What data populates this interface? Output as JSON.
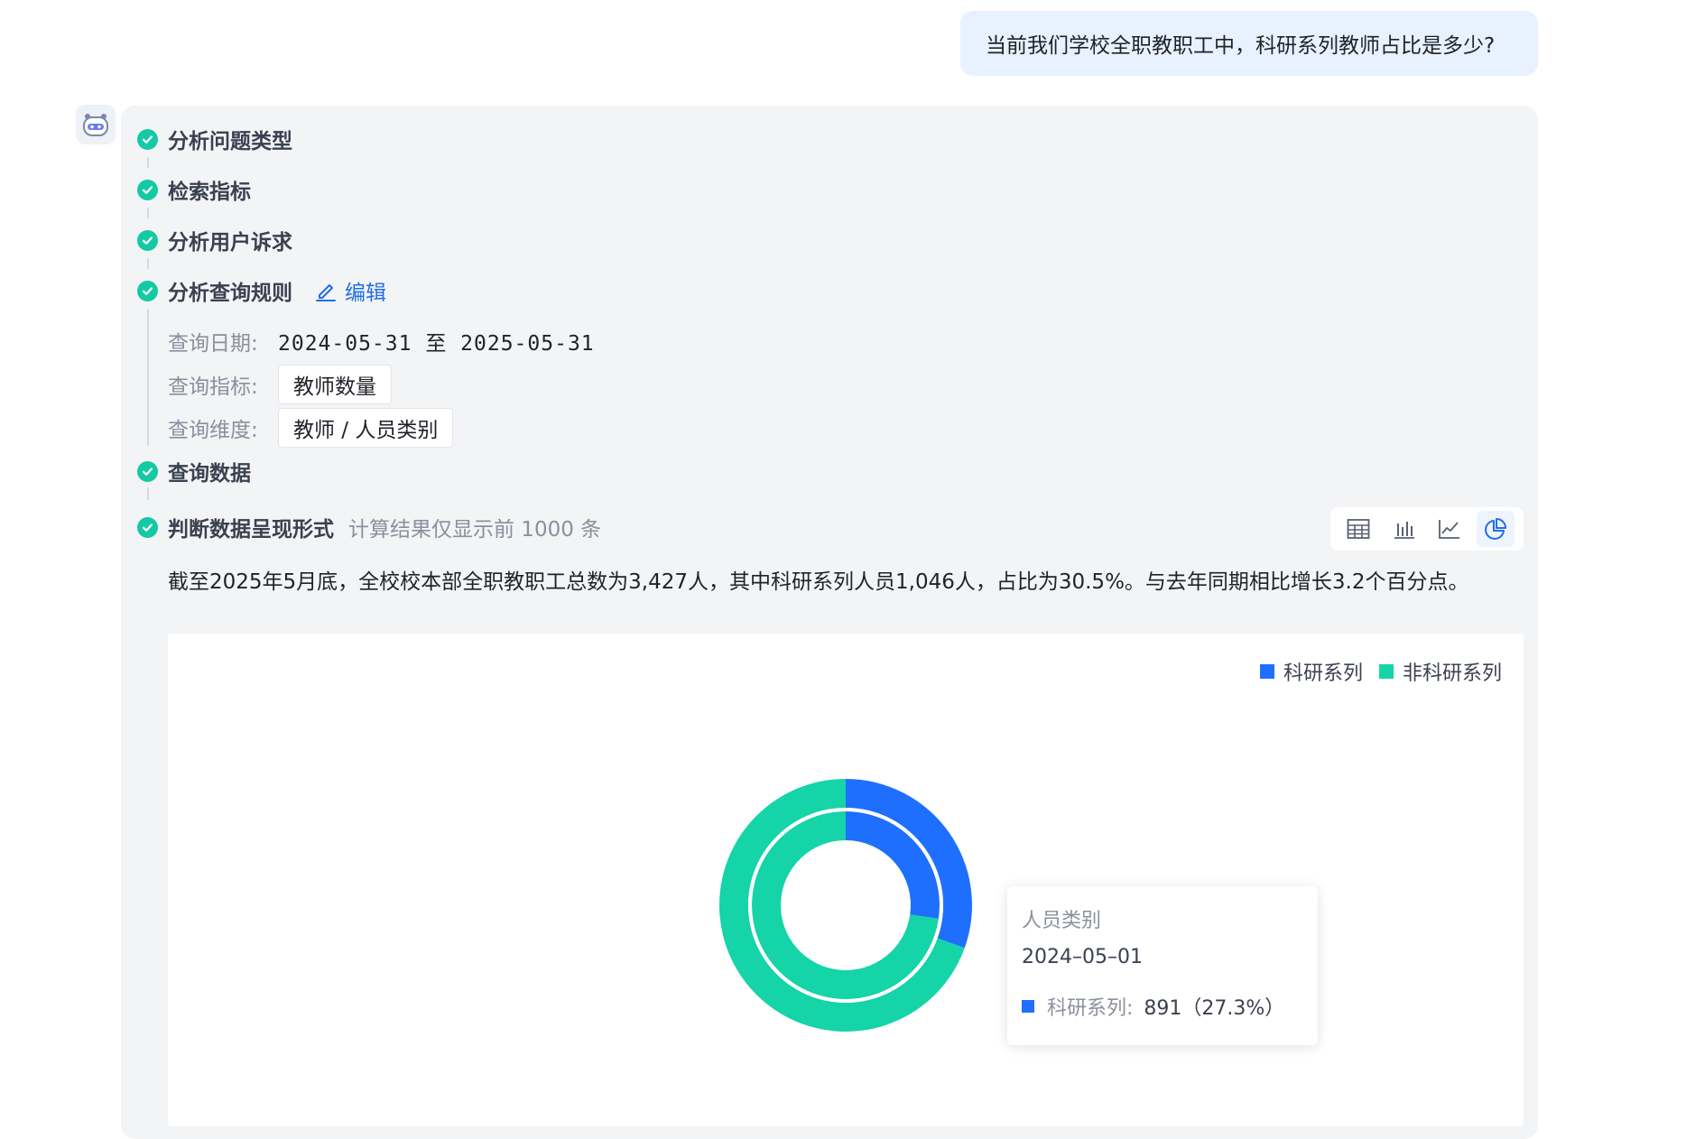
{
  "user_message": "当前我们学校全职教职工中，科研系列教师占比是多少?",
  "steps": {
    "s1": "分析问题类型",
    "s2": "检索指标",
    "s3": "分析用户诉求",
    "s4": "分析查询规则",
    "edit_label": "编辑",
    "s5": "查询数据",
    "s6": "判断数据呈现形式",
    "s6_hint": "计算结果仅显示前 1000 条"
  },
  "rules": {
    "date_label": "查询日期:",
    "date_value": "2024-05-31 至 2025-05-31",
    "metric_label": "查询指标:",
    "metric_value": "教师数量",
    "dimension_label": "查询维度:",
    "dimension_value": "教师 / 人员类别"
  },
  "summary": "截至2025年5月底，全校校本部全职教职工总数为3,427人，其中科研系列人员1,046人，占比为30.5%。与去年同期相比增长3.2个百分点。",
  "toolbar": {
    "icons": [
      "table-icon",
      "bar-chart-icon",
      "line-chart-icon",
      "pie-chart-icon"
    ],
    "active": "pie-chart-icon"
  },
  "colors": {
    "research": "#1f6fff",
    "non_research": "#14d4a8",
    "check": "#14c9a3",
    "link": "#1f6fe5"
  },
  "chart_data": {
    "type": "pie",
    "subtype": "nested-donut",
    "legend_position": "top-right",
    "legend": [
      "科研系列",
      "非科研系列"
    ],
    "rings": [
      {
        "ring": "outer",
        "slices": [
          {
            "name": "科研系列",
            "value": 30.5
          },
          {
            "name": "非科研系列",
            "value": 69.5
          }
        ]
      },
      {
        "ring": "inner",
        "slices": [
          {
            "name": "科研系列",
            "value": 27.3
          },
          {
            "name": "非科研系列",
            "value": 72.7
          }
        ]
      }
    ]
  },
  "tooltip": {
    "title": "人员类别",
    "date": "2024–05–01",
    "series_label": "科研系列:",
    "series_value": "891（27.3%）"
  }
}
